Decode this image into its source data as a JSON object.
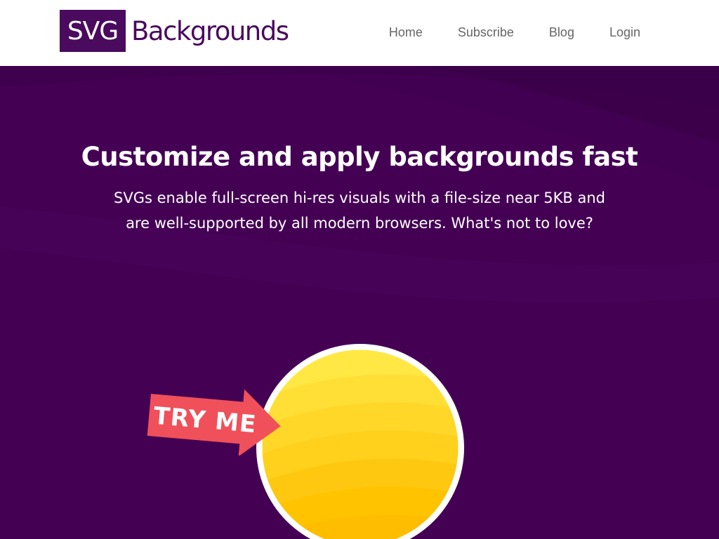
{
  "header": {
    "logo_box_text": "SVG",
    "logo_text": "Backgrounds",
    "nav": [
      {
        "label": "Home"
      },
      {
        "label": "Subscribe"
      },
      {
        "label": "Blog"
      },
      {
        "label": "Login"
      }
    ]
  },
  "hero": {
    "title": "Customize and apply backgrounds fast",
    "subtitle": "SVGs enable full-screen hi-res visuals with a file-size near 5KB and are well-supported by all modern browsers. What's not to love?",
    "cta_label": "TRY ME"
  },
  "colors": {
    "brand": "#4a0a5e",
    "hero_bg": "#440154",
    "cta_arrow": "#f0505a",
    "circle_top": "#fff56a",
    "circle_bottom": "#ffbd00"
  },
  "icons": {
    "cta_arrow": "arrow-right-icon"
  }
}
